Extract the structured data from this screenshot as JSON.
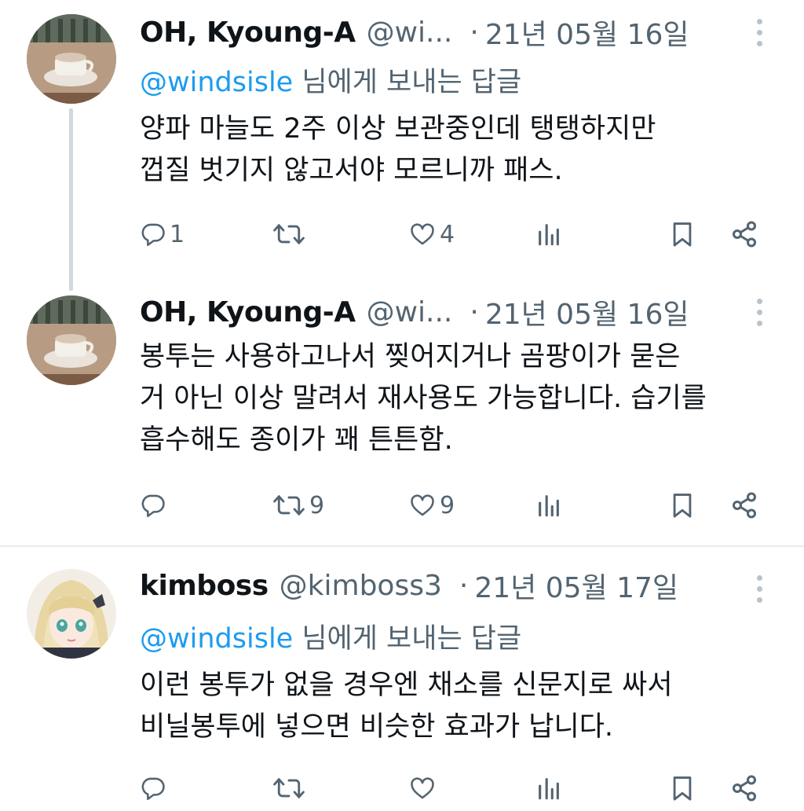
{
  "tweets": [
    {
      "name": "OH, Kyoung-A",
      "handle": "@wi...",
      "date": "21년 05월 16일",
      "separator": "·",
      "replying_to": "@windsisle",
      "replying_suffix": " 님에게 보내는 답글",
      "lines": [
        "양파 마늘도 2주 이상 보관중인데 탱탱하지만",
        "껍질 벗기지 않고서야 모르니까 패스."
      ],
      "reply_count": "1",
      "retweet_count": "",
      "like_count": "4"
    },
    {
      "name": "OH, Kyoung-A",
      "handle": "@wi...",
      "date": "21년 05월 16일",
      "separator": "·",
      "lines": [
        "봉투는 사용하고나서 찢어지거나 곰팡이가 묻은",
        "거 아닌 이상 말려서 재사용도 가능합니다. 습기를",
        "흡수해도 종이가 꽤 튼튼함."
      ],
      "reply_count": "",
      "retweet_count": "9",
      "like_count": "9"
    },
    {
      "name": "kimboss",
      "handle": "@kimboss3",
      "date": "21년 05월 17일",
      "separator": "·",
      "replying_to": "@windsisle",
      "replying_suffix": " 님에게 보내는 답글",
      "lines": [
        "이런 봉투가 없을 경우엔 채소를 신문지로 싸서",
        "비닐봉투에 넣으면 비슷한 효과가 납니다."
      ],
      "reply_count": "",
      "retweet_count": "",
      "like_count": ""
    }
  ],
  "icons": {
    "reply": "reply-icon",
    "retweet": "retweet-icon",
    "like": "heart-icon",
    "views": "views-icon",
    "bookmark": "bookmark-icon",
    "share": "share-icon",
    "more": "more-icon"
  },
  "colors": {
    "text": "#0f1419",
    "secondary": "#536471",
    "link": "#1d9bf0",
    "thread_line": "#cfd9de"
  }
}
